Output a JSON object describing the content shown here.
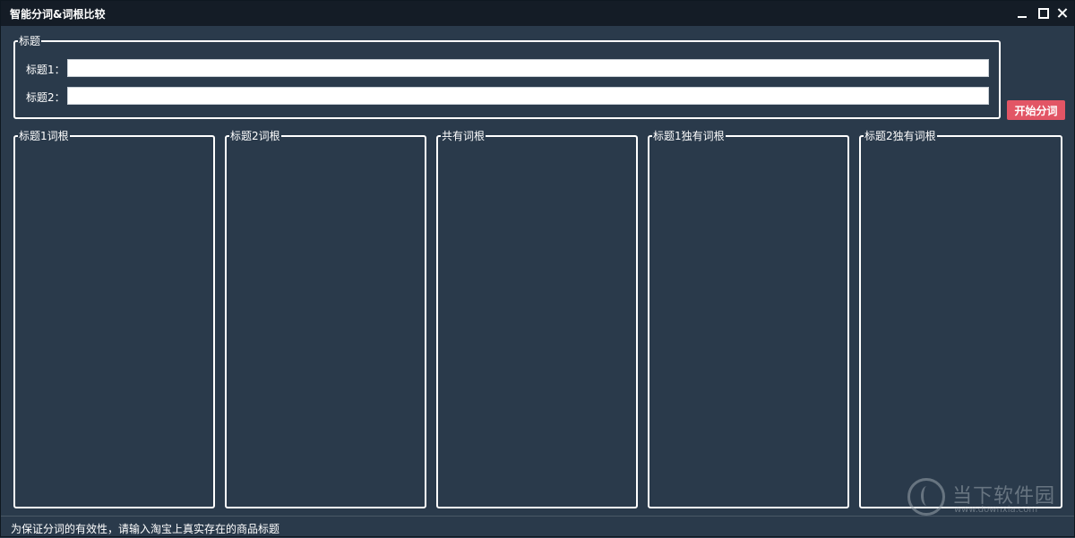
{
  "window": {
    "title": "智能分词&词根比较",
    "minimize_icon": "minimize-icon",
    "maximize_icon": "maximize-icon",
    "close_icon": "close-icon"
  },
  "title_group": {
    "legend": "标题",
    "row1_label": "标题1：",
    "row1_value": "",
    "row2_label": "标题2：",
    "row2_value": ""
  },
  "actions": {
    "start_label": "开始分词",
    "start_color": "#e25565"
  },
  "panels": [
    {
      "legend": "标题1词根"
    },
    {
      "legend": "标题2词根"
    },
    {
      "legend": "共有词根"
    },
    {
      "legend": "标题1独有词根"
    },
    {
      "legend": "标题2独有词根"
    }
  ],
  "status": {
    "text": "为保证分词的有效性，请输入淘宝上真实存在的商品标题"
  },
  "watermark": {
    "name": "当下软件园",
    "url": "www.downxia.com"
  },
  "colors": {
    "background": "#2a3a4b",
    "titlebar": "#141c26",
    "accent": "#e25565"
  }
}
